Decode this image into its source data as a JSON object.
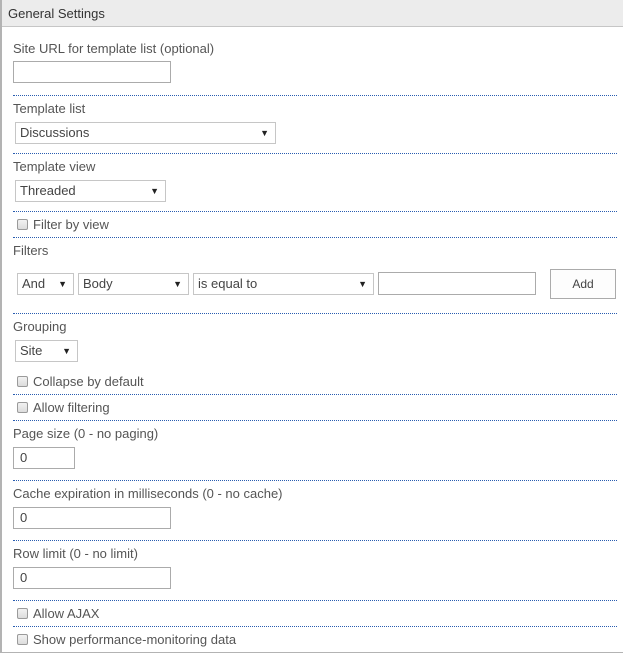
{
  "header": {
    "title": "General Settings"
  },
  "site_url": {
    "label": "Site URL for template list (optional)",
    "value": ""
  },
  "template_list": {
    "label": "Template list",
    "selected": "Discussions"
  },
  "template_view": {
    "label": "Template view",
    "selected": "Threaded"
  },
  "filter_by_view": {
    "label": "Filter by view",
    "checked": false
  },
  "filters": {
    "label": "Filters",
    "operator": "And",
    "field": "Body",
    "condition": "is equal to",
    "value": "",
    "add_label": "Add"
  },
  "grouping": {
    "label": "Grouping",
    "selected": "Site"
  },
  "collapse_by_default": {
    "label": "Collapse by default",
    "checked": false
  },
  "allow_filtering": {
    "label": "Allow filtering",
    "checked": false
  },
  "page_size": {
    "label": "Page size (0 - no paging)",
    "value": "0"
  },
  "cache_expiration": {
    "label": "Cache expiration in milliseconds (0 - no cache)",
    "value": "0"
  },
  "row_limit": {
    "label": "Row limit (0 - no limit)",
    "value": "0"
  },
  "allow_ajax": {
    "label": "Allow AJAX",
    "checked": false
  },
  "show_perf": {
    "label": "Show performance-monitoring data",
    "checked": false
  },
  "icons": {
    "dropdown_arrow": "▼"
  }
}
